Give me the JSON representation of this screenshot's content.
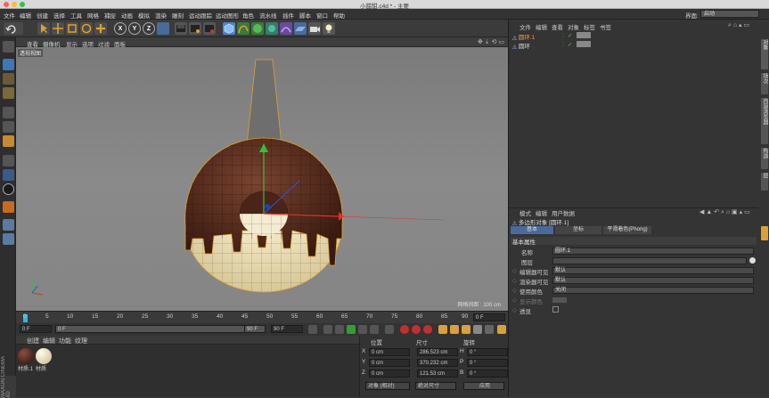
{
  "window": {
    "title": "小甜甜.c4d * - 主要"
  },
  "menubar": {
    "items": [
      "文件",
      "编辑",
      "创建",
      "选择",
      "工具",
      "网格",
      "捕捉",
      "动画",
      "模拟",
      "渲染",
      "雕刻",
      "运动跟踪",
      "运动图形",
      "角色",
      "流水线",
      "插件",
      "脚本",
      "窗口",
      "帮助"
    ],
    "layout_label": "界面:",
    "layout_value": "启动"
  },
  "toolbar": {
    "axis_x": "X",
    "axis_y": "Y",
    "axis_z": "Z"
  },
  "viewport": {
    "menu": [
      "查看",
      "摄像机",
      "显示",
      "选项",
      "过滤",
      "面板"
    ],
    "view_label": "透视视图",
    "grid_spacing": "网格间距 : 100 cm"
  },
  "timeline": {
    "ticks": [
      "0",
      "5",
      "10",
      "15",
      "20",
      "25",
      "30",
      "35",
      "40",
      "45",
      "50",
      "55",
      "60",
      "65",
      "70",
      "75",
      "80",
      "85",
      "90"
    ],
    "frame_end": "0 F"
  },
  "playback": {
    "current": "0 F",
    "start": "0 F",
    "end": "90 F",
    "end2": "90 F"
  },
  "materials": {
    "menu": [
      "创建",
      "编辑",
      "功能",
      "纹理"
    ],
    "items": [
      {
        "name": "材质.1"
      },
      {
        "name": "材质"
      }
    ],
    "brand": "MAXON CINEMA 4D"
  },
  "coords": {
    "headers": [
      "位置",
      "尺寸",
      "旋转"
    ],
    "rows": [
      {
        "axis": "X",
        "pos": "0 cm",
        "size": "286.523 cm",
        "rot_label": "H",
        "rot": "0 °"
      },
      {
        "axis": "Y",
        "pos": "0 cm",
        "size": "370.232 cm",
        "rot_label": "P",
        "rot": "0 °"
      },
      {
        "axis": "Z",
        "pos": "0 cm",
        "size": "121.53 cm",
        "rot_label": "B",
        "rot": "0 °"
      }
    ],
    "mode": "对象 (相对)",
    "size_mode": "绝对尺寸",
    "apply": "应用"
  },
  "objects": {
    "menu": [
      "文件",
      "编辑",
      "查看",
      "对象",
      "标签",
      "书签"
    ],
    "items": [
      {
        "name": "圆环.1"
      },
      {
        "name": "圆环"
      }
    ]
  },
  "attributes": {
    "menu": [
      "模式",
      "编辑",
      "用户数据"
    ],
    "object_title": "多边形对象 [圆环.1]",
    "tabs": [
      "基本",
      "坐标",
      "平滑着色(Phong)"
    ],
    "section": "基本属性",
    "props": [
      {
        "label": "名称",
        "value": "圆环.1"
      },
      {
        "label": "图层",
        "value": ""
      },
      {
        "label": "编辑器可见",
        "value": "默认"
      },
      {
        "label": "渲染器可见",
        "value": "默认"
      },
      {
        "label": "使用颜色",
        "value": "关闭"
      },
      {
        "label": "显示颜色",
        "value": ""
      },
      {
        "label": "透显",
        "value": ""
      }
    ]
  },
  "side_tabs": [
    "对象",
    "场次",
    "内容浏览器",
    "构造",
    "层"
  ],
  "colors": {
    "accent": "#e0a030",
    "selection": "#4a6a9a",
    "choc": "#4a2418",
    "cream": "#f0e6c0"
  }
}
